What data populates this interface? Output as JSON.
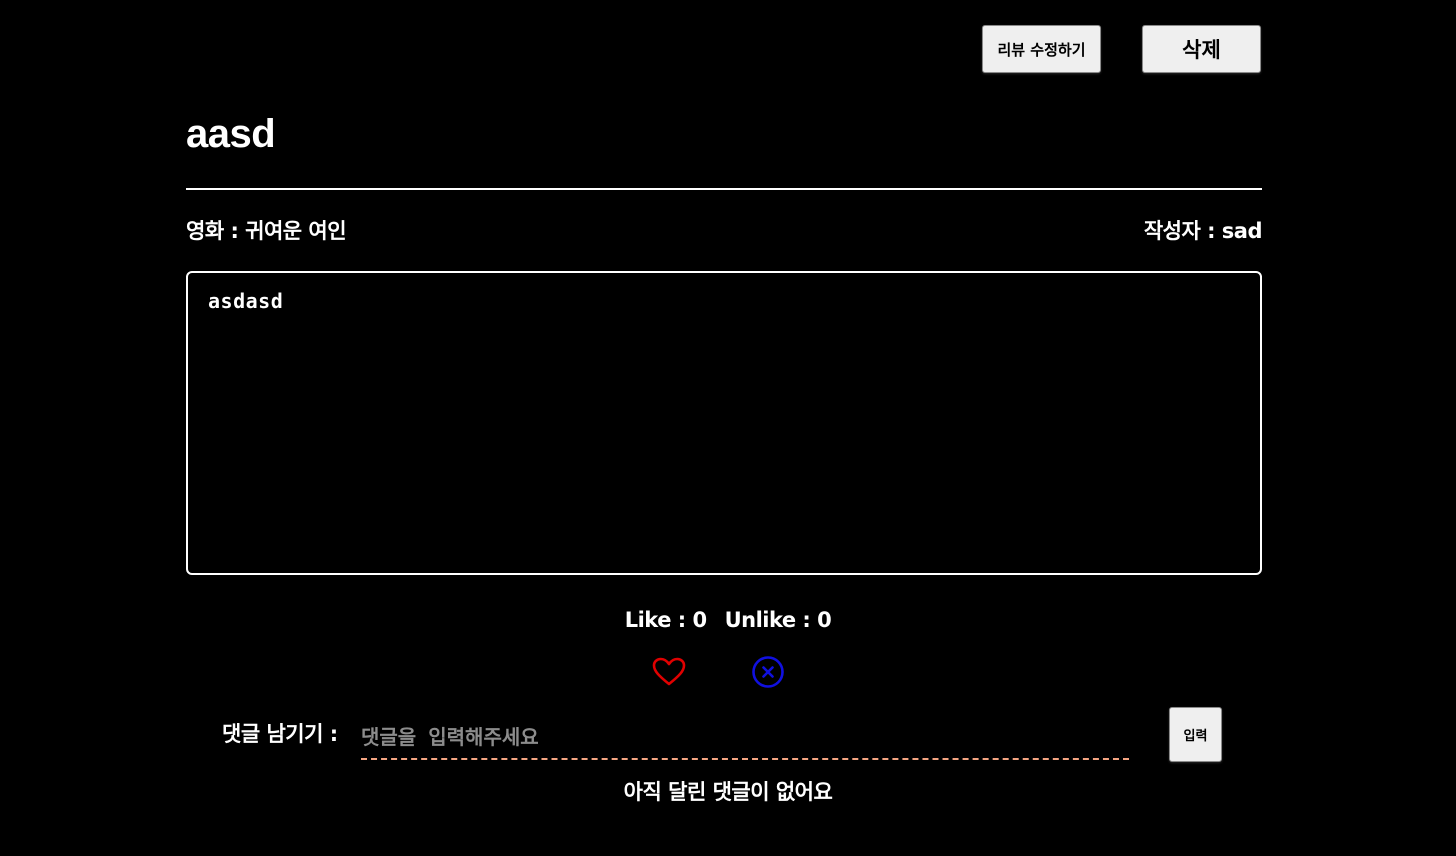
{
  "actions": {
    "edit_label": "리뷰 수정하기",
    "delete_label": "삭제"
  },
  "review": {
    "title": "aasd",
    "movie_label": "영화 : 귀여운 여인",
    "author_label": "작성자 : sad",
    "content": "asdasd"
  },
  "reactions": {
    "like_text": "Like : 0",
    "unlike_text": "Unlike : 0",
    "like_icon": "heart-icon",
    "unlike_icon": "x-circle-icon",
    "like_color": "#e00000",
    "unlike_color": "#1010e0"
  },
  "comments": {
    "label": "댓글 남기기 :",
    "placeholder": "댓글을 입력해주세요",
    "value": "",
    "submit_label": "입력",
    "empty_text": "아직 달린 댓글이 없어요"
  },
  "colors": {
    "background": "#000000",
    "text": "#ffffff",
    "button_bg": "#efefef",
    "input_underline": "#f4a582"
  }
}
